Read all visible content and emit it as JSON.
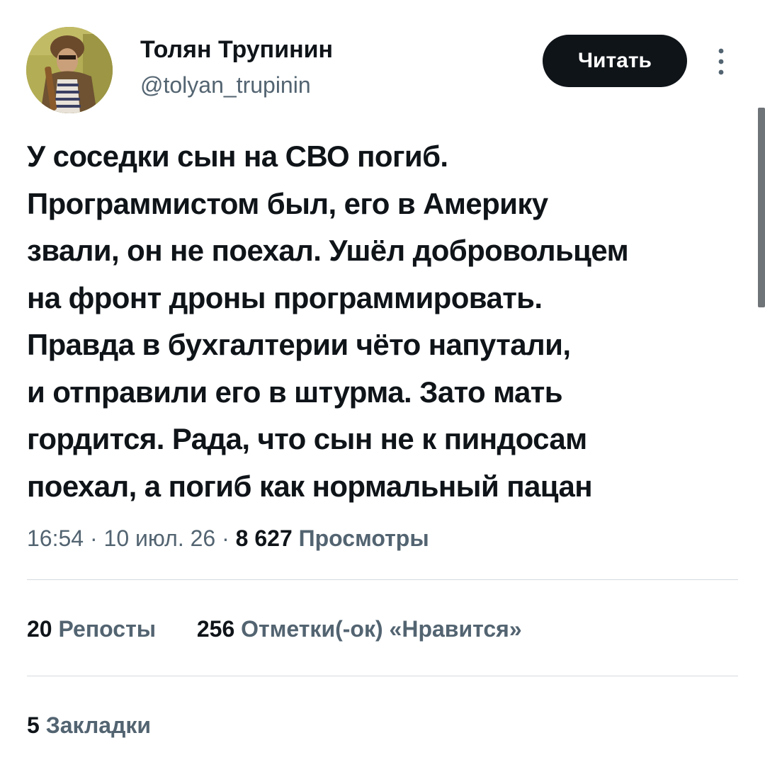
{
  "author": {
    "name": "Толян Трупинин",
    "handle": "@tolyan_trupinin"
  },
  "follow_button": {
    "label": "Читать"
  },
  "tweet": {
    "text": "У соседки сын на СВО погиб.\nПрограммистом был, его в Америку\nзвали, он не поехал. Ушёл добровольцем\nна фронт дроны программировать.\nПравда в бухгалтерии чёто напутали,\nи отправили его в штурма. Зато мать\nгордится. Рада, что сын не к пиндосам\nпоехал, а погиб как нормальный пацан"
  },
  "meta": {
    "time": "16:54",
    "date": "10 июл. 26",
    "separator": "·",
    "views_count": "8 627",
    "views_label": "Просмотры"
  },
  "stats": {
    "reposts_count": "20",
    "reposts_label": "Репосты",
    "likes_count": "256",
    "likes_label": "Отметки(-ок) «Нравится»",
    "bookmarks_count": "5",
    "bookmarks_label": "Закладки"
  },
  "icons": {
    "more": "more-vertical-icon"
  },
  "colors": {
    "text_primary": "#0f1419",
    "text_secondary": "#536471",
    "button_bg": "#0f1419",
    "button_text": "#ffffff",
    "divider": "#d4dadf"
  }
}
